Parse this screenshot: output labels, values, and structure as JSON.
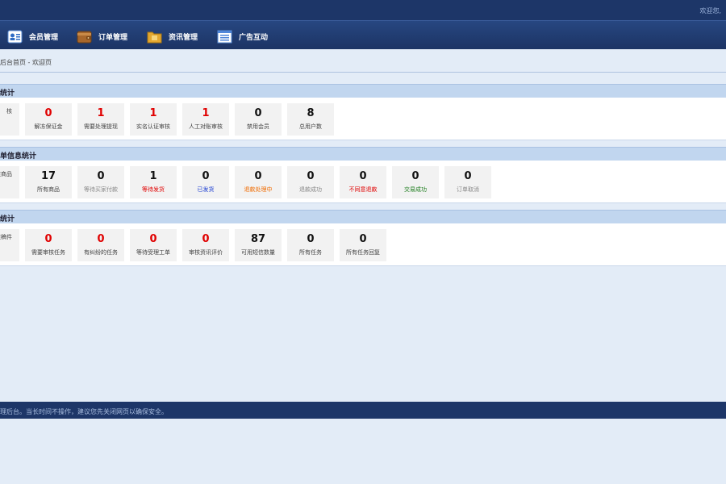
{
  "header": {
    "welcome": "欢迎您,"
  },
  "nav": [
    {
      "label": "会员管理",
      "icon": "member-card-icon"
    },
    {
      "label": "订单管理",
      "icon": "wallet-icon"
    },
    {
      "label": "资讯管理",
      "icon": "folder-icon"
    },
    {
      "label": "广告互动",
      "icon": "list-window-icon"
    }
  ],
  "breadcrumb": "后台首页 - 欢迎页",
  "sections": [
    {
      "title": "统计",
      "tiles": [
        {
          "value": "",
          "label": "核"
        },
        {
          "value": "0",
          "label": "解冻保证金"
        },
        {
          "value": "1",
          "label": "需要处理提现"
        },
        {
          "value": "1",
          "label": "实名认证审核"
        },
        {
          "value": "1",
          "label": "人工对账审核"
        },
        {
          "value": "0",
          "label": "禁用会员"
        },
        {
          "value": "8",
          "label": "总用户数"
        }
      ]
    },
    {
      "title": "单信息统计",
      "tiles": [
        {
          "value": "",
          "label": "核商品"
        },
        {
          "value": "17",
          "label": "所有商品"
        },
        {
          "value": "0",
          "label": "等待买家付款"
        },
        {
          "value": "1",
          "label": "等待发货"
        },
        {
          "value": "0",
          "label": "已发货"
        },
        {
          "value": "0",
          "label": "退款处理中"
        },
        {
          "value": "0",
          "label": "退款成功"
        },
        {
          "value": "0",
          "label": "不同意退款"
        },
        {
          "value": "0",
          "label": "交易成功"
        },
        {
          "value": "0",
          "label": "订单取消"
        }
      ]
    },
    {
      "title": "统计",
      "tiles": [
        {
          "value": "",
          "label": "核稿件"
        },
        {
          "value": "0",
          "label": "需要审核任务"
        },
        {
          "value": "0",
          "label": "有纠纷的任务"
        },
        {
          "value": "0",
          "label": "等待受理工单"
        },
        {
          "value": "0",
          "label": "审核资讯评价"
        },
        {
          "value": "87",
          "label": "可用短信数量"
        },
        {
          "value": "0",
          "label": "所有任务"
        },
        {
          "value": "0",
          "label": "所有任务回复"
        }
      ]
    }
  ],
  "footer": {
    "text": "理后台。当长时间不操作，建议您先关闭网页以确保安全。"
  },
  "colors": {
    "navy": "#1d3668",
    "red": "#e00000",
    "blue": "#1a3cd1",
    "orange": "#f06b00",
    "green": "#1e7d1e"
  }
}
